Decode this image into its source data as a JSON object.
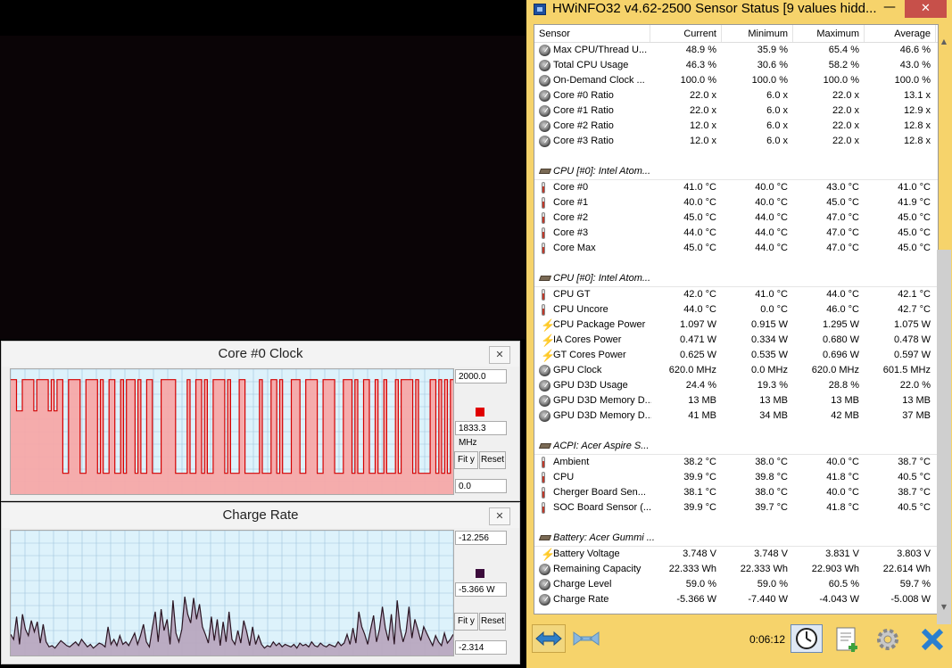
{
  "graphs": [
    {
      "title": "Core #0 Clock",
      "max_label": "2000.0",
      "current_label": "1833.3 MHz",
      "min_label": "0.0",
      "fit_label": "Fit y",
      "reset_label": "Reset",
      "line_color": "#d40000",
      "fill_color": "#f5a8a8",
      "swatch_color": "#e00000",
      "ymin": 0,
      "ymax": 2000,
      "values": [
        1833,
        1833,
        1333,
        1333,
        1833,
        1833,
        1833,
        1833,
        1333,
        1833,
        1833,
        1833,
        1833,
        1333,
        1833,
        1333,
        1833,
        1833,
        333,
        333,
        1833,
        1833,
        1833,
        1833,
        333,
        333,
        1833,
        1833,
        1833,
        1833,
        333,
        1833,
        333,
        333,
        1833,
        1833,
        333,
        333,
        1833,
        333,
        1833,
        1833,
        1833,
        333,
        1833,
        333,
        333,
        1833,
        1833,
        333,
        333,
        333,
        1833,
        1833,
        1833,
        1833,
        1833,
        333,
        333,
        333,
        333,
        1833,
        333,
        333,
        1833,
        1833,
        333,
        1833,
        333,
        333,
        1833,
        1833,
        1833,
        1833,
        333,
        1833,
        333,
        333,
        333,
        1833,
        1833,
        333,
        333,
        333,
        333,
        333,
        1833,
        333,
        333,
        333,
        1833,
        1833,
        333,
        1833,
        333,
        333,
        333,
        1833,
        1833,
        1833,
        333,
        333,
        1833,
        1833,
        1833,
        1833,
        333,
        333,
        1833,
        1833,
        1833,
        1833,
        333,
        333,
        333,
        1833,
        1833,
        1833,
        333,
        1833,
        333,
        333,
        1833,
        1833,
        333,
        333,
        1833,
        333,
        333,
        1833,
        333,
        333,
        333,
        1833,
        333,
        1833,
        1833,
        1833,
        1833,
        333,
        1833,
        333,
        333,
        333,
        333,
        1833,
        1833,
        333,
        1833,
        333,
        1833,
        333,
        1833,
        1833
      ]
    },
    {
      "title": "Charge Rate",
      "max_label": "-12.256",
      "current_label": "-5.366 W",
      "min_label": "-2.314",
      "fit_label": "Fit y",
      "reset_label": "Reset",
      "line_color": "#2a1422",
      "fill_color": "#b8a8c0",
      "swatch_color": "#3b0b3b",
      "ymin": -2.314,
      "ymax": -12.256,
      "values": [
        -4.0,
        -3.6,
        -5.4,
        -3.2,
        -5.6,
        -4.4,
        -3.9,
        -5.1,
        -4.2,
        -5.0,
        -3.3,
        -4.8,
        -3.4,
        -3.0,
        -3.1,
        -2.9,
        -3.2,
        -3.5,
        -3.3,
        -3.1,
        -3.0,
        -3.2,
        -3.4,
        -3.1,
        -3.6,
        -3.3,
        -3.0,
        -3.2,
        -2.9,
        -3.1,
        -3.3,
        -3.2,
        -3.0,
        -4.6,
        -3.2,
        -3.6,
        -3.1,
        -3.9,
        -3.2,
        -3.4,
        -3.1,
        -3.6,
        -4.1,
        -3.2,
        -3.9,
        -4.8,
        -3.4,
        -3.0,
        -4.5,
        -5.8,
        -3.4,
        -6.0,
        -4.3,
        -5.2,
        -3.2,
        -6.7,
        -4.1,
        -3.4,
        -4.4,
        -7.0,
        -5.6,
        -4.9,
        -6.9,
        -5.2,
        -6.4,
        -4.6,
        -4.0,
        -3.3,
        -5.4,
        -3.5,
        -5.2,
        -3.1,
        -5.0,
        -3.4,
        -5.8,
        -3.6,
        -3.2,
        -4.3,
        -3.3,
        -5.1,
        -4.2,
        -3.1,
        -4.6,
        -3.2,
        -3.9,
        -3.2,
        -2.9,
        -3.1,
        -3.0,
        -3.4,
        -3.1,
        -3.3,
        -3.0,
        -3.2,
        -3.1,
        -3.0,
        -3.2,
        -2.9,
        -3.3,
        -3.1,
        -3.2,
        -3.0,
        -3.4,
        -3.1,
        -3.0,
        -3.3,
        -3.1,
        -3.0,
        -3.2,
        -3.1,
        -3.0,
        -3.4,
        -3.1,
        -3.3,
        -4.0,
        -3.2,
        -4.5,
        -3.3,
        -5.8,
        -4.6,
        -4.0,
        -3.2,
        -4.4,
        -5.5,
        -3.4,
        -4.4,
        -6.2,
        -4.5,
        -3.5,
        -5.6,
        -3.2,
        -6.7,
        -4.5,
        -3.4,
        -4.2,
        -6.2,
        -3.7,
        -5.2,
        -4.4,
        -3.5,
        -4.6,
        -4.1,
        -3.6,
        -3.1,
        -3.9,
        -3.4,
        -3.1,
        -4.1,
        -3.3,
        -3.6,
        -4.0
      ]
    }
  ],
  "hwinfo": {
    "title": "HWiNFO32 v4.62-2500 Sensor Status [9 values hidd...",
    "minimize_label": "—",
    "close_label": "✕",
    "headers": {
      "sensor": "Sensor",
      "current": "Current",
      "minimum": "Minimum",
      "maximum": "Maximum",
      "average": "Average"
    },
    "rows": [
      {
        "type": "data",
        "icon": "gauge-icon",
        "name": "Max CPU/Thread U...",
        "cur": "48.9 %",
        "min": "35.9 %",
        "max": "65.4 %",
        "avg": "46.6 %"
      },
      {
        "type": "data",
        "icon": "gauge-icon",
        "name": "Total CPU Usage",
        "cur": "46.3 %",
        "min": "30.6 %",
        "max": "58.2 %",
        "avg": "43.0 %"
      },
      {
        "type": "data",
        "icon": "gauge-icon",
        "name": "On-Demand Clock ...",
        "cur": "100.0 %",
        "min": "100.0 %",
        "max": "100.0 %",
        "avg": "100.0 %"
      },
      {
        "type": "data",
        "icon": "gauge-icon",
        "name": "Core #0 Ratio",
        "cur": "22.0 x",
        "min": "6.0 x",
        "max": "22.0 x",
        "avg": "13.1 x"
      },
      {
        "type": "data",
        "icon": "gauge-icon",
        "name": "Core #1 Ratio",
        "cur": "22.0 x",
        "min": "6.0 x",
        "max": "22.0 x",
        "avg": "12.9 x"
      },
      {
        "type": "data",
        "icon": "gauge-icon",
        "name": "Core #2 Ratio",
        "cur": "12.0 x",
        "min": "6.0 x",
        "max": "22.0 x",
        "avg": "12.8 x"
      },
      {
        "type": "data",
        "icon": "gauge-icon",
        "name": "Core #3 Ratio",
        "cur": "12.0 x",
        "min": "6.0 x",
        "max": "22.0 x",
        "avg": "12.8 x"
      },
      {
        "type": "blank"
      },
      {
        "type": "group",
        "icon": "chip-icon",
        "name": "CPU [#0]: Intel Atom..."
      },
      {
        "type": "data",
        "icon": "thermometer-icon",
        "name": "Core #0",
        "cur": "41.0 °C",
        "min": "40.0 °C",
        "max": "43.0 °C",
        "avg": "41.0 °C"
      },
      {
        "type": "data",
        "icon": "thermometer-icon",
        "name": "Core #1",
        "cur": "40.0 °C",
        "min": "40.0 °C",
        "max": "45.0 °C",
        "avg": "41.9 °C"
      },
      {
        "type": "data",
        "icon": "thermometer-icon",
        "name": "Core #2",
        "cur": "45.0 °C",
        "min": "44.0 °C",
        "max": "47.0 °C",
        "avg": "45.0 °C"
      },
      {
        "type": "data",
        "icon": "thermometer-icon",
        "name": "Core #3",
        "cur": "44.0 °C",
        "min": "44.0 °C",
        "max": "47.0 °C",
        "avg": "45.0 °C"
      },
      {
        "type": "data",
        "icon": "thermometer-icon",
        "name": "Core Max",
        "cur": "45.0 °C",
        "min": "44.0 °C",
        "max": "47.0 °C",
        "avg": "45.0 °C"
      },
      {
        "type": "blank"
      },
      {
        "type": "group",
        "icon": "chip-icon",
        "name": "CPU [#0]: Intel Atom..."
      },
      {
        "type": "data",
        "icon": "thermometer-icon",
        "name": "CPU GT",
        "cur": "42.0 °C",
        "min": "41.0 °C",
        "max": "44.0 °C",
        "avg": "42.1 °C"
      },
      {
        "type": "data",
        "icon": "thermometer-icon",
        "name": "CPU Uncore",
        "cur": "44.0 °C",
        "min": "0.0 °C",
        "max": "46.0 °C",
        "avg": "42.7 °C"
      },
      {
        "type": "data",
        "icon": "bolt-icon",
        "name": "CPU Package Power",
        "cur": "1.097 W",
        "min": "0.915 W",
        "max": "1.295 W",
        "avg": "1.075 W"
      },
      {
        "type": "data",
        "icon": "bolt-icon",
        "name": "IA Cores Power",
        "cur": "0.471 W",
        "min": "0.334 W",
        "max": "0.680 W",
        "avg": "0.478 W"
      },
      {
        "type": "data",
        "icon": "bolt-icon",
        "name": "GT Cores Power",
        "cur": "0.625 W",
        "min": "0.535 W",
        "max": "0.696 W",
        "avg": "0.597 W"
      },
      {
        "type": "data",
        "icon": "gauge-icon",
        "name": "GPU Clock",
        "cur": "620.0 MHz",
        "min": "0.0 MHz",
        "max": "620.0 MHz",
        "avg": "601.5 MHz"
      },
      {
        "type": "data",
        "icon": "gauge-icon",
        "name": "GPU D3D Usage",
        "cur": "24.4 %",
        "min": "19.3 %",
        "max": "28.8 %",
        "avg": "22.0 %"
      },
      {
        "type": "data",
        "icon": "gauge-icon",
        "name": "GPU D3D Memory D...",
        "cur": "13 MB",
        "min": "13 MB",
        "max": "13 MB",
        "avg": "13 MB"
      },
      {
        "type": "data",
        "icon": "gauge-icon",
        "name": "GPU D3D Memory D...",
        "cur": "41 MB",
        "min": "34 MB",
        "max": "42 MB",
        "avg": "37 MB"
      },
      {
        "type": "blank"
      },
      {
        "type": "group",
        "icon": "chip-icon",
        "name": "ACPI: Acer Aspire S..."
      },
      {
        "type": "data",
        "icon": "thermometer-icon",
        "name": "Ambient",
        "cur": "38.2 °C",
        "min": "38.0 °C",
        "max": "40.0 °C",
        "avg": "38.7 °C"
      },
      {
        "type": "data",
        "icon": "thermometer-icon",
        "name": "CPU",
        "cur": "39.9 °C",
        "min": "39.8 °C",
        "max": "41.8 °C",
        "avg": "40.5 °C"
      },
      {
        "type": "data",
        "icon": "thermometer-icon",
        "name": "Cherger Board Sen...",
        "cur": "38.1 °C",
        "min": "38.0 °C",
        "max": "40.0 °C",
        "avg": "38.7 °C"
      },
      {
        "type": "data",
        "icon": "thermometer-icon",
        "name": "SOC Board Sensor (...",
        "cur": "39.9 °C",
        "min": "39.7 °C",
        "max": "41.8 °C",
        "avg": "40.5 °C"
      },
      {
        "type": "blank"
      },
      {
        "type": "group",
        "icon": "chip-icon",
        "name": "Battery: Acer Gummi ..."
      },
      {
        "type": "data",
        "icon": "bolt-icon",
        "name": "Battery Voltage",
        "cur": "3.748 V",
        "min": "3.748 V",
        "max": "3.831 V",
        "avg": "3.803 V"
      },
      {
        "type": "data",
        "icon": "gauge-icon",
        "name": "Remaining Capacity",
        "cur": "22.333 Wh",
        "min": "22.333 Wh",
        "max": "22.903 Wh",
        "avg": "22.614 Wh"
      },
      {
        "type": "data",
        "icon": "gauge-icon",
        "name": "Charge Level",
        "cur": "59.0 %",
        "min": "59.0 %",
        "max": "60.5 %",
        "avg": "59.7 %"
      },
      {
        "type": "data",
        "icon": "gauge-icon",
        "name": "Charge Rate",
        "cur": "-5.366 W",
        "min": "-7.440 W",
        "max": "-4.043 W",
        "avg": "-5.008 W"
      }
    ],
    "elapsed_time": "0:06:12"
  }
}
